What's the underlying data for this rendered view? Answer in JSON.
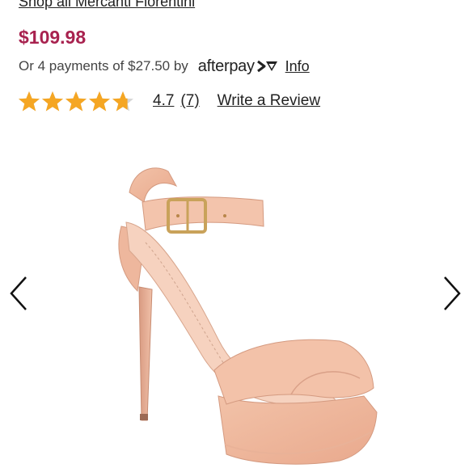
{
  "shop_link": "Shop all Mercanti Fiorentini",
  "price": "$109.98",
  "payments": {
    "text": "Or 4 payments of $27.50 by",
    "provider": "afterpay",
    "info_label": "Info"
  },
  "rating": {
    "value": "4.7",
    "stars_fill": 0.94,
    "count": "(7)",
    "write_review": "Write a Review"
  },
  "product_image": {
    "icon": "pink-platform-sandal-image"
  },
  "carousel": {
    "prev_icon": "chevron-left-icon",
    "next_icon": "chevron-right-icon"
  },
  "colors": {
    "price": "#a8224f",
    "star": "#f5a623",
    "afterpay_accent": "#222222"
  }
}
